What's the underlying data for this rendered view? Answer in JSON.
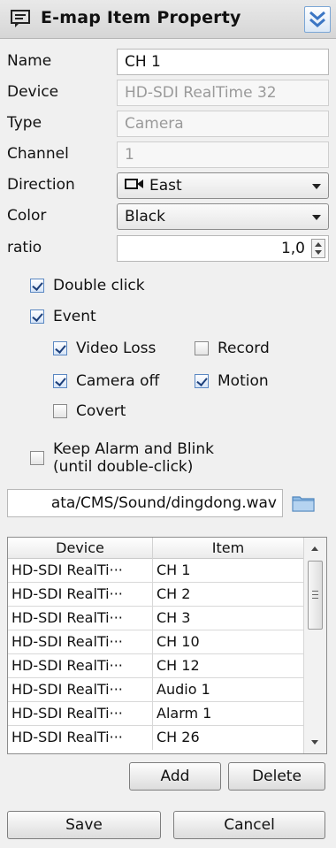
{
  "title": "E-map Item Property",
  "properties": {
    "name_label": "Name",
    "name_value": "CH 1",
    "device_label": "Device",
    "device_value": "HD-SDI RealTime 32",
    "type_label": "Type",
    "type_value": "Camera",
    "channel_label": "Channel",
    "channel_value": "1",
    "direction_label": "Direction",
    "direction_value": "East",
    "color_label": "Color",
    "color_value": "Black",
    "ratio_label": "ratio",
    "ratio_value": "1,0"
  },
  "options": {
    "double_click": {
      "label": "Double click",
      "checked": true
    },
    "event": {
      "label": "Event",
      "checked": true
    },
    "video_loss": {
      "label": "Video Loss",
      "checked": true
    },
    "record": {
      "label": "Record",
      "checked": false
    },
    "camera_off": {
      "label": "Camera off",
      "checked": true
    },
    "motion": {
      "label": "Motion",
      "checked": true
    },
    "covert": {
      "label": "Covert",
      "checked": false
    },
    "keep_alarm_line1": "Keep Alarm and Blink",
    "keep_alarm_line2": "(until double-click)",
    "keep_alarm_checked": false
  },
  "sound_path": "ata/CMS/Sound/dingdong.wav",
  "table": {
    "headers": [
      "Device",
      "Item"
    ],
    "rows": [
      [
        "HD-SDI RealTi···",
        "CH 1"
      ],
      [
        "HD-SDI RealTi···",
        "CH 2"
      ],
      [
        "HD-SDI RealTi···",
        "CH 3"
      ],
      [
        "HD-SDI RealTi···",
        "CH 10"
      ],
      [
        "HD-SDI RealTi···",
        "CH 12"
      ],
      [
        "HD-SDI RealTi···",
        "Audio 1"
      ],
      [
        "HD-SDI RealTi···",
        "Alarm 1"
      ],
      [
        "HD-SDI RealTi···",
        "CH 26"
      ]
    ]
  },
  "buttons": {
    "add": "Add",
    "delete": "Delete",
    "save": "Save",
    "cancel": "Cancel"
  },
  "colors": {
    "accent": "#5a87c2",
    "check": "#1d3f7a",
    "folder": "#8fbbe4"
  }
}
